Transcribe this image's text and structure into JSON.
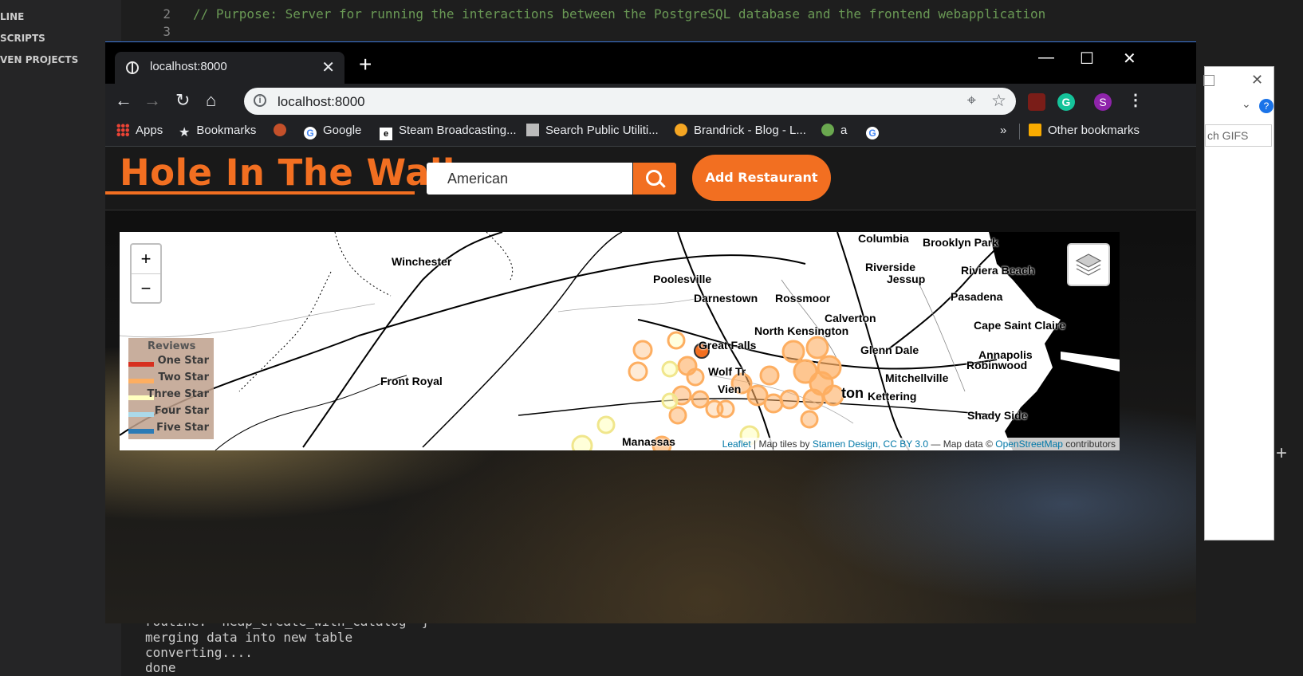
{
  "vscode": {
    "sidebar_sections": [
      "LINE",
      "SCRIPTS",
      "VEN PROJECTS"
    ],
    "editor_lines": [
      {
        "num": "2",
        "text": "// Purpose: Server for running the interactions between the PostgreSQL database and the frontend webapplication"
      },
      {
        "num": "3",
        "text": ""
      }
    ],
    "terminal_lines": [
      "  routine: 'heap_create_with_catalog' }",
      "merging data into new table",
      "converting....",
      "done"
    ]
  },
  "background_window": {
    "search_placeholder": "ch GIFS"
  },
  "browser": {
    "tab_title": "localhost:8000",
    "url": "localhost:8000",
    "bookmarks": [
      "Apps",
      "Bookmarks",
      "Google",
      "Steam Broadcasting...",
      "Search Public Utiliti...",
      "Brandrick - Blog - L...",
      "a"
    ],
    "overflow": "»",
    "other_bookmarks": "Other bookmarks",
    "profile_initial": "S"
  },
  "app": {
    "brand": "Hole In The Wall",
    "search_value": "American",
    "add_button": "Add Restaurant"
  },
  "map": {
    "zoom_in": "+",
    "zoom_out": "−",
    "legend": {
      "title": "Reviews",
      "items": [
        {
          "label": "One Star",
          "color": "#d7301f"
        },
        {
          "label": "Two Star",
          "color": "#fdae61"
        },
        {
          "label": "Three Star",
          "color": "#ffffbf"
        },
        {
          "label": "Four Star",
          "color": "#abd9e9"
        },
        {
          "label": "Five Star",
          "color": "#2c7bb6"
        }
      ]
    },
    "cities": [
      "Columbia",
      "Brooklyn Park",
      "Winchester",
      "Riverside",
      "Riviera Beach",
      "Poolesville",
      "Jessup",
      "Darnestown",
      "Rossmoor",
      "Pasadena",
      "Calverton",
      "North Kensington",
      "Cape Saint Claire",
      "Great Falls",
      "Glenn Dale",
      "Annapolis",
      "Robinwood",
      "Wolf Tr",
      "Vien",
      "Front Royal",
      "Mitchellville",
      "ton",
      "Kettering",
      "Shady Side",
      "Manassas"
    ],
    "attribution": {
      "leaflet": "Leaflet",
      "tiles_prefix": " | Map tiles by ",
      "stamen": "Stamen Design, CC BY 3.0",
      "data_prefix": " — Map data © ",
      "osm": "OpenStreetMap",
      "suffix": " contributors"
    }
  }
}
